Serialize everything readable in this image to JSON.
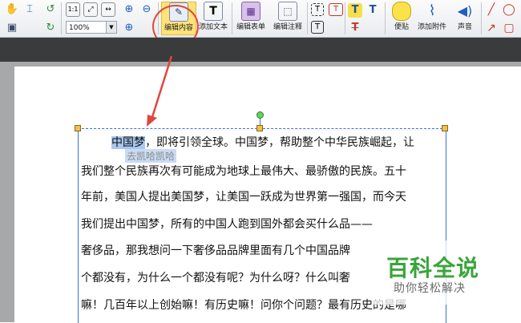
{
  "toolbar": {
    "zoom_value": "100%",
    "buttons": [
      {
        "label": "编辑内容",
        "icon": "edit-content-icon"
      },
      {
        "label": "添加文本",
        "icon": "add-text-icon"
      },
      {
        "label": "编辑表单",
        "icon": "edit-form-icon"
      },
      {
        "label": "编辑注释",
        "icon": "edit-annotation-icon"
      },
      {
        "label": "便贴",
        "icon": "sticky-note-icon"
      },
      {
        "label": "添加附件",
        "icon": "attachment-icon"
      },
      {
        "label": "声音",
        "icon": "sound-icon"
      }
    ],
    "accent_color": "#e0463e"
  },
  "document": {
    "selected_text": "中国梦",
    "lines": [
      "，即将引领全球。中国梦，帮助整个中华民族崛起，让",
      "我们整个民族再次有可能成为地球上最伟大、最骄傲的民族。五十",
      "年前，美国人提出美国梦，让美国一跃成为世界第一强国，而今天",
      "我们提出中国梦，所有的中国人跑到国外都会买什么品——",
      "奢侈品，那我想问一下奢侈品品牌里面有几个中国品牌",
      "个都没有，为什么一个都没有呢？为什么呀？什么叫奢",
      "嘛！几百年以上创始嘛！有历史嘛！问你个问题？最有历史的是哪"
    ],
    "ghost_text": "去凯哈凯哈"
  },
  "watermark": {
    "title": "百科全说",
    "subtitle": "助你轻松解决"
  }
}
